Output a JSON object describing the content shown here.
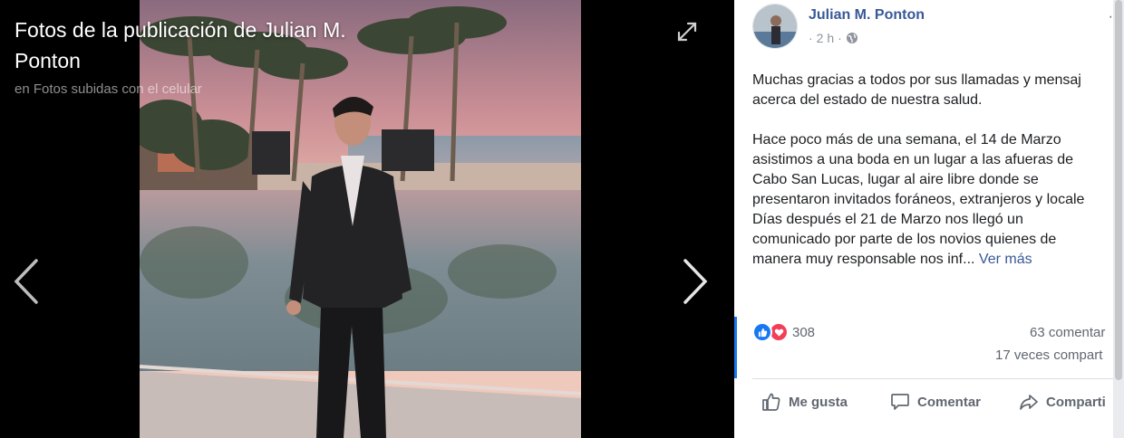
{
  "viewer": {
    "title": "Fotos de la publicación de Julian M. Ponton",
    "album": "en Fotos subidas con el celular",
    "expand_icon": "expand-icon",
    "prev_icon": "chevron-left-icon",
    "next_icon": "chevron-right-icon"
  },
  "post": {
    "author": "Julian M. Ponton",
    "time": "2 h",
    "separator": "·",
    "privacy_icon": "globe-icon",
    "more_label": "·",
    "paragraphs": [
      "Muchas gracias a todos por sus llamadas y mensaj",
      "acerca del estado de nuestra salud."
    ],
    "paragraph2_lines": [
      "Hace poco más de una semana, el 14 de Marzo",
      "asistimos a una boda en un lugar a las afueras de",
      "Cabo San Lucas, lugar al aire libre donde se",
      "presentaron invitados foráneos, extranjeros y locale",
      "Días después el 21 de Marzo nos llegó un",
      "comunicado por parte de los novios quienes de"
    ],
    "last_line": "manera muy responsable nos inf...",
    "see_more": "Ver más"
  },
  "stats": {
    "reactions_count": "308",
    "comments": "63 comentar",
    "shares": "17 veces compart"
  },
  "actions": {
    "like": "Me gusta",
    "comment": "Comentar",
    "share": "Comparti"
  },
  "colors": {
    "link": "#385898",
    "like_blue": "#1877f2",
    "love_red": "#f33e58"
  }
}
